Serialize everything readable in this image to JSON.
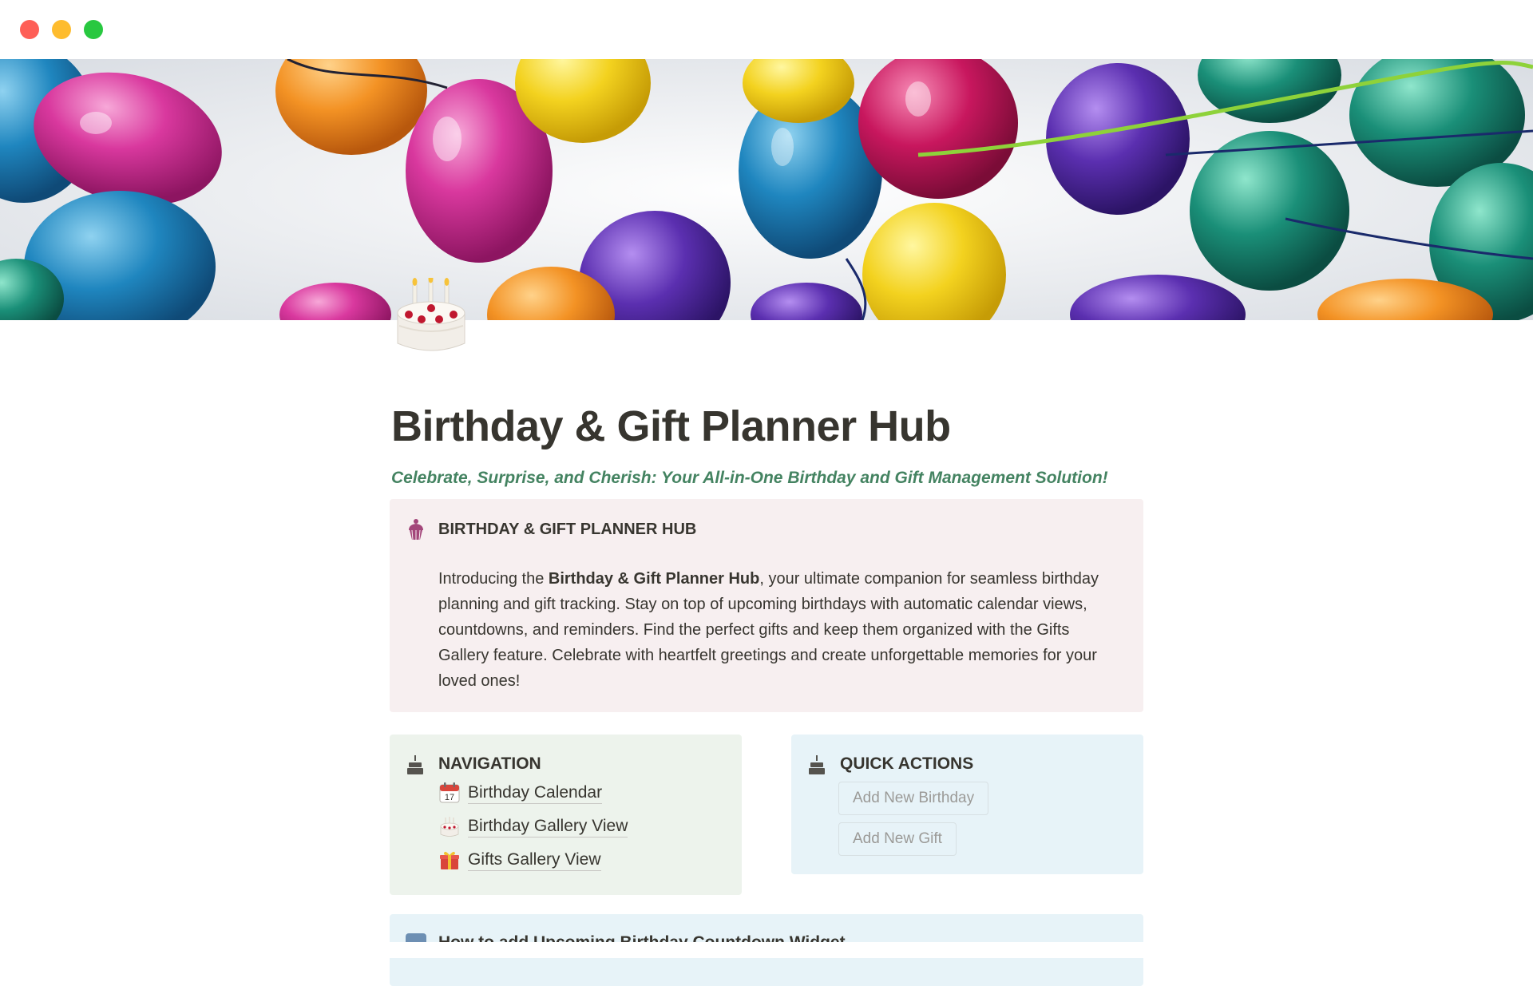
{
  "window": {
    "controls": [
      "close",
      "minimize",
      "zoom"
    ],
    "colors": {
      "close": "#fe5f57",
      "minimize": "#febc2e",
      "zoom": "#28c840"
    }
  },
  "cover": {
    "description_icon": "balloons-cover-image"
  },
  "page": {
    "icon": "birthday-cake-icon",
    "title": "Birthday & Gift Planner Hub",
    "subtitle": "Celebrate, Surprise, and Cherish: Your All-in-One Birthday and Gift Management Solution!"
  },
  "intro_callout": {
    "icon": "cupcake-icon",
    "heading": "BIRTHDAY & GIFT PLANNER HUB",
    "body_before": "Introducing the ",
    "body_bold": "Birthday & Gift Planner Hub",
    "body_after": ", your ultimate companion for seamless birthday planning and gift tracking. Stay on top of upcoming birthdays with automatic calendar views, countdowns, and reminders. Find the perfect gifts and keep them organized with the Gifts Gallery feature. Celebrate with heartfelt greetings and create unforgettable memories for your loved ones!",
    "background": "#f7eff0"
  },
  "navigation": {
    "icon": "cake-icon",
    "title": "NAVIGATION",
    "background": "#edf3ec",
    "links": [
      {
        "icon": "calendar-icon",
        "label": "Birthday Calendar"
      },
      {
        "icon": "birthday-cake-icon",
        "label": "Birthday Gallery View"
      },
      {
        "icon": "gift-icon",
        "label": "Gifts Gallery View"
      }
    ]
  },
  "quick_actions": {
    "icon": "cake-icon",
    "title": "QUICK ACTIONS",
    "background": "#e7f3f8",
    "buttons": [
      "Add New Birthday",
      "Add New Gift"
    ]
  },
  "bottom_callout": {
    "icon": "info-icon",
    "text": "How to add Upcoming Birthday Countdown Widget"
  }
}
